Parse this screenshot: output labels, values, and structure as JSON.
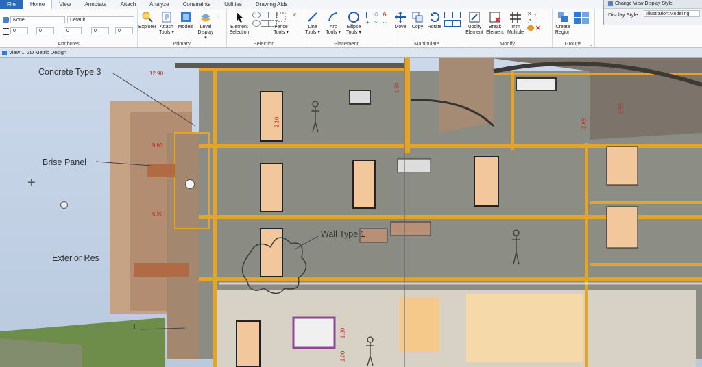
{
  "menubar": {
    "items": [
      {
        "label": "File",
        "active": false,
        "file": true
      },
      {
        "label": "Home",
        "active": true,
        "file": false
      },
      {
        "label": "View",
        "active": false,
        "file": false
      },
      {
        "label": "Annotate",
        "active": false,
        "file": false
      },
      {
        "label": "Attach",
        "active": false,
        "file": false
      },
      {
        "label": "Analyze",
        "active": false,
        "file": false
      },
      {
        "label": "Constraints",
        "active": false,
        "file": false
      },
      {
        "label": "Utilities",
        "active": false,
        "file": false
      },
      {
        "label": "Drawing Aids",
        "active": false,
        "file": false
      }
    ]
  },
  "attributes": {
    "level_value": "None",
    "style_value": "Default",
    "weight_values": [
      "0",
      "0",
      "0",
      "0",
      "0"
    ],
    "group_label": "Attributes"
  },
  "primary": {
    "group_label": "Primary",
    "tools": [
      {
        "l1": "Explorer",
        "l2": "",
        "icon": "explorer-icon"
      },
      {
        "l1": "Attach",
        "l2": "Tools ▾",
        "icon": "attach-icon"
      },
      {
        "l1": "Models",
        "l2": "",
        "icon": "models-icon"
      },
      {
        "l1": "Level",
        "l2": "Display ▾",
        "icon": "level-display-icon"
      }
    ]
  },
  "selection": {
    "group_label": "Selection",
    "tools": [
      {
        "l1": "Element",
        "l2": "Selection",
        "icon": "element-selection-icon"
      },
      {
        "l1": "Fence",
        "l2": "Tools ▾",
        "icon": "fence-icon"
      }
    ]
  },
  "placement": {
    "group_label": "Placement",
    "tools": [
      {
        "l1": "Line",
        "l2": "Tools ▾",
        "icon": "line-icon"
      },
      {
        "l1": "Arc",
        "l2": "Tools ▾",
        "icon": "arc-icon"
      },
      {
        "l1": "Ellipse",
        "l2": "Tools ▾",
        "icon": "ellipse-icon"
      }
    ]
  },
  "manipulate": {
    "group_label": "Manipulate",
    "tools": [
      {
        "l1": "Move",
        "l2": "",
        "icon": "move-icon"
      },
      {
        "l1": "Copy",
        "l2": "",
        "icon": "copy-icon"
      },
      {
        "l1": "Rotate",
        "l2": "",
        "icon": "rotate-icon"
      }
    ]
  },
  "modify": {
    "group_label": "Modify",
    "tools": [
      {
        "l1": "Modify",
        "l2": "Element",
        "icon": "modify-element-icon"
      },
      {
        "l1": "Break",
        "l2": "Element",
        "icon": "break-element-icon"
      },
      {
        "l1": "Trim",
        "l2": "Multiple",
        "icon": "trim-multiple-icon"
      }
    ]
  },
  "groups": {
    "group_label": "Groups",
    "tools": [
      {
        "l1": "Create",
        "l2": "Region",
        "icon": "create-region-icon"
      }
    ]
  },
  "dialog": {
    "title": "Change View Display Style",
    "field_label": "Display Style:",
    "field_value": "Illustration:Modeling"
  },
  "view": {
    "title": "View 1, 3D Metric Design"
  },
  "annotations": {
    "concrete": "Concrete Type 3",
    "brise": "Brise Panel",
    "exterior": "Exterior Res",
    "wall": "Wall Type 1",
    "marker": "1"
  },
  "dimensions": [
    "12.90",
    "9.60",
    "6.90",
    "2.10",
    "2.65",
    "2.55",
    "1.00",
    "1.20",
    "1.80"
  ],
  "colors": {
    "accent": "#2a6ab7",
    "slab": "#e3a42a",
    "dimension": "#d21f1f",
    "wall": "#8c8f86",
    "door": "#f3c79c",
    "sky": "#c9d7e8"
  }
}
